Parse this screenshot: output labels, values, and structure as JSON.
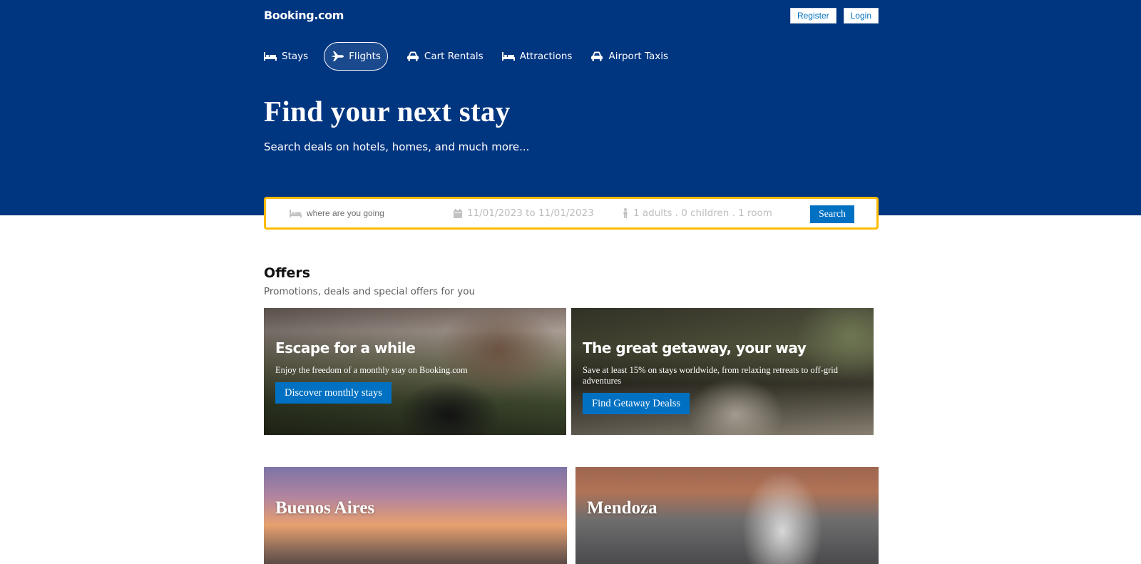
{
  "header": {
    "logo": "Booking.com",
    "register_label": "Register",
    "login_label": "Login"
  },
  "nav": {
    "items": [
      {
        "label": "Stays",
        "icon": "bed-icon"
      },
      {
        "label": "Flights",
        "icon": "plane-icon",
        "active": true
      },
      {
        "label": "Cart Rentals",
        "icon": "car-icon"
      },
      {
        "label": "Attractions",
        "icon": "bed-icon"
      },
      {
        "label": "Airport Taxis",
        "icon": "car-icon"
      }
    ]
  },
  "hero": {
    "title": "Find your next stay",
    "subtitle": "Search deals on hotels, homes, and much more..."
  },
  "search": {
    "destination_placeholder": "where are you going",
    "dates": "11/01/2023 to 11/01/2023",
    "guests": "1 adults . 0 children . 1 room",
    "button_label": "Search"
  },
  "offers": {
    "title": "Offers",
    "subtitle": "Promotions, deals and special offers for you",
    "cards": [
      {
        "title": "Escape for a while",
        "text": "Enjoy the freedom of a monthly stay on Booking.com",
        "button_label": "Discover monthly stays"
      },
      {
        "title": "The great getaway, your way",
        "text": "Save at least 15% on stays worldwide, from relaxing retreats to off-grid adventures",
        "button_label": "Find Getaway Dealss"
      }
    ]
  },
  "destinations": [
    {
      "name": "Buenos Aires"
    },
    {
      "name": "Mendoza"
    }
  ],
  "colors": {
    "brand_blue": "#003580",
    "accent_blue": "#0071c2",
    "search_border": "#febb02"
  }
}
